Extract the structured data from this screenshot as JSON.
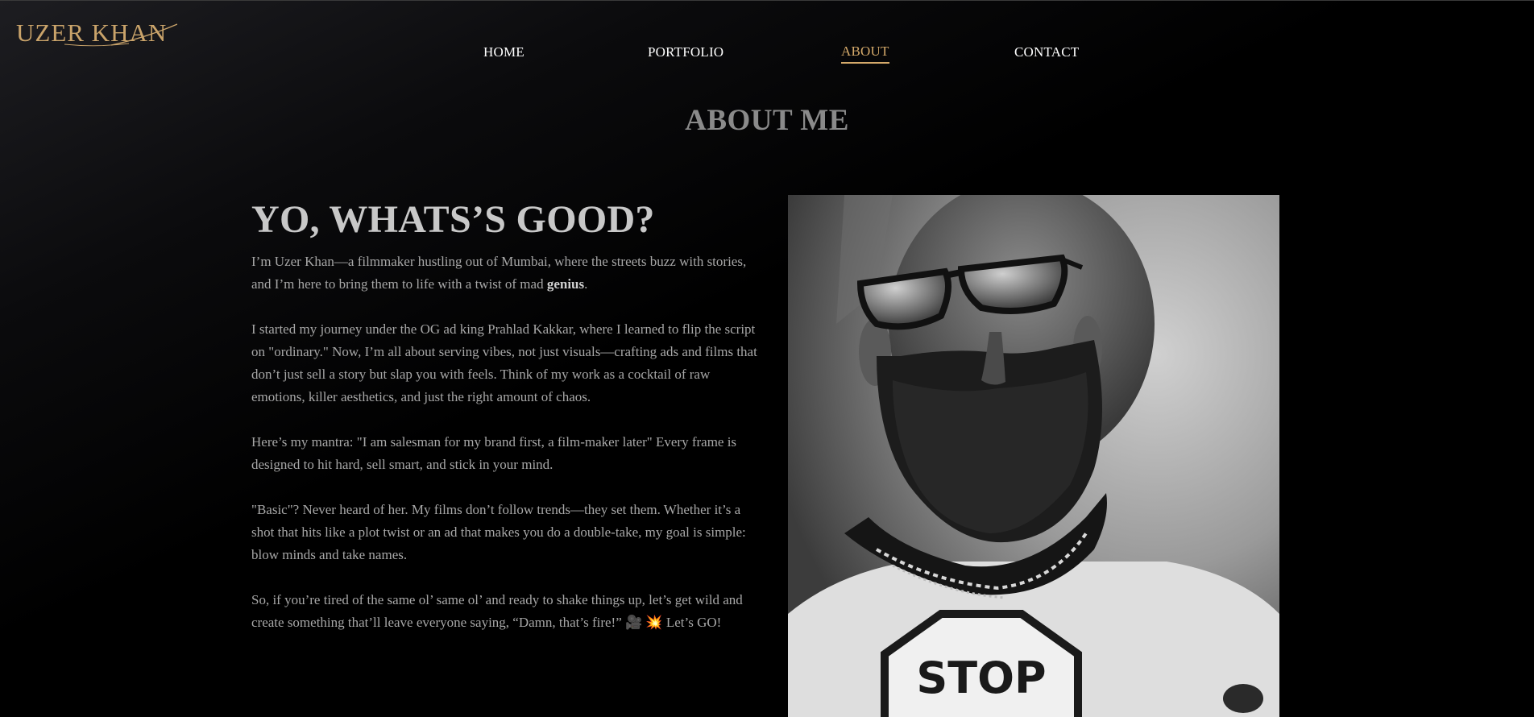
{
  "brand": {
    "logo_text": "UZER KHAN"
  },
  "nav": {
    "items": [
      {
        "label": "HOME",
        "active": false
      },
      {
        "label": "PORTFOLIO",
        "active": false
      },
      {
        "label": "ABOUT",
        "active": true
      },
      {
        "label": "CONTACT",
        "active": false
      }
    ]
  },
  "page": {
    "title": "ABOUT ME",
    "heading": "YO, WHATS’S GOOD?",
    "p1_text": "I’m Uzer Khan—a filmmaker hustling out of Mumbai, where the streets buzz with stories, and I’m here to bring them to life with a twist of mad ",
    "p1_bold": "genius",
    "p1_end": ".",
    "p2": "I started my journey under the OG ad king Prahlad Kakkar, where I learned to flip the script on \"ordinary.\" Now, I’m all about serving vibes, not just visuals—crafting ads and films that don’t just sell a story but slap you with feels. Think of my work as a cocktail of raw emotions, killer aesthetics, and just the right amount of chaos.",
    "p3": "Here’s my mantra: \"I am salesman for my brand first, a film-maker later\" Every frame is designed to hit hard, sell smart, and stick in your mind.",
    "p4": "\"Basic\"? Never heard of her. My films don’t follow trends—they set them. Whether it’s a shot that hits like a plot twist or an ad that makes you do a double-take, my goal is simple: blow minds and take names.",
    "p5": "So, if you’re tired of the same ol’ same ol’ and ready to shake things up, let’s get wild and create something that’ll leave everyone saying, “Damn, that’s fire!” 🎥 💥 Let’s GO!"
  },
  "photo": {
    "shirt_text": "STOP"
  },
  "colors": {
    "accent": "#d4a96a",
    "background": "#000000",
    "body_text": "#a7a7a7",
    "heading_text": "#c8c8c8"
  }
}
